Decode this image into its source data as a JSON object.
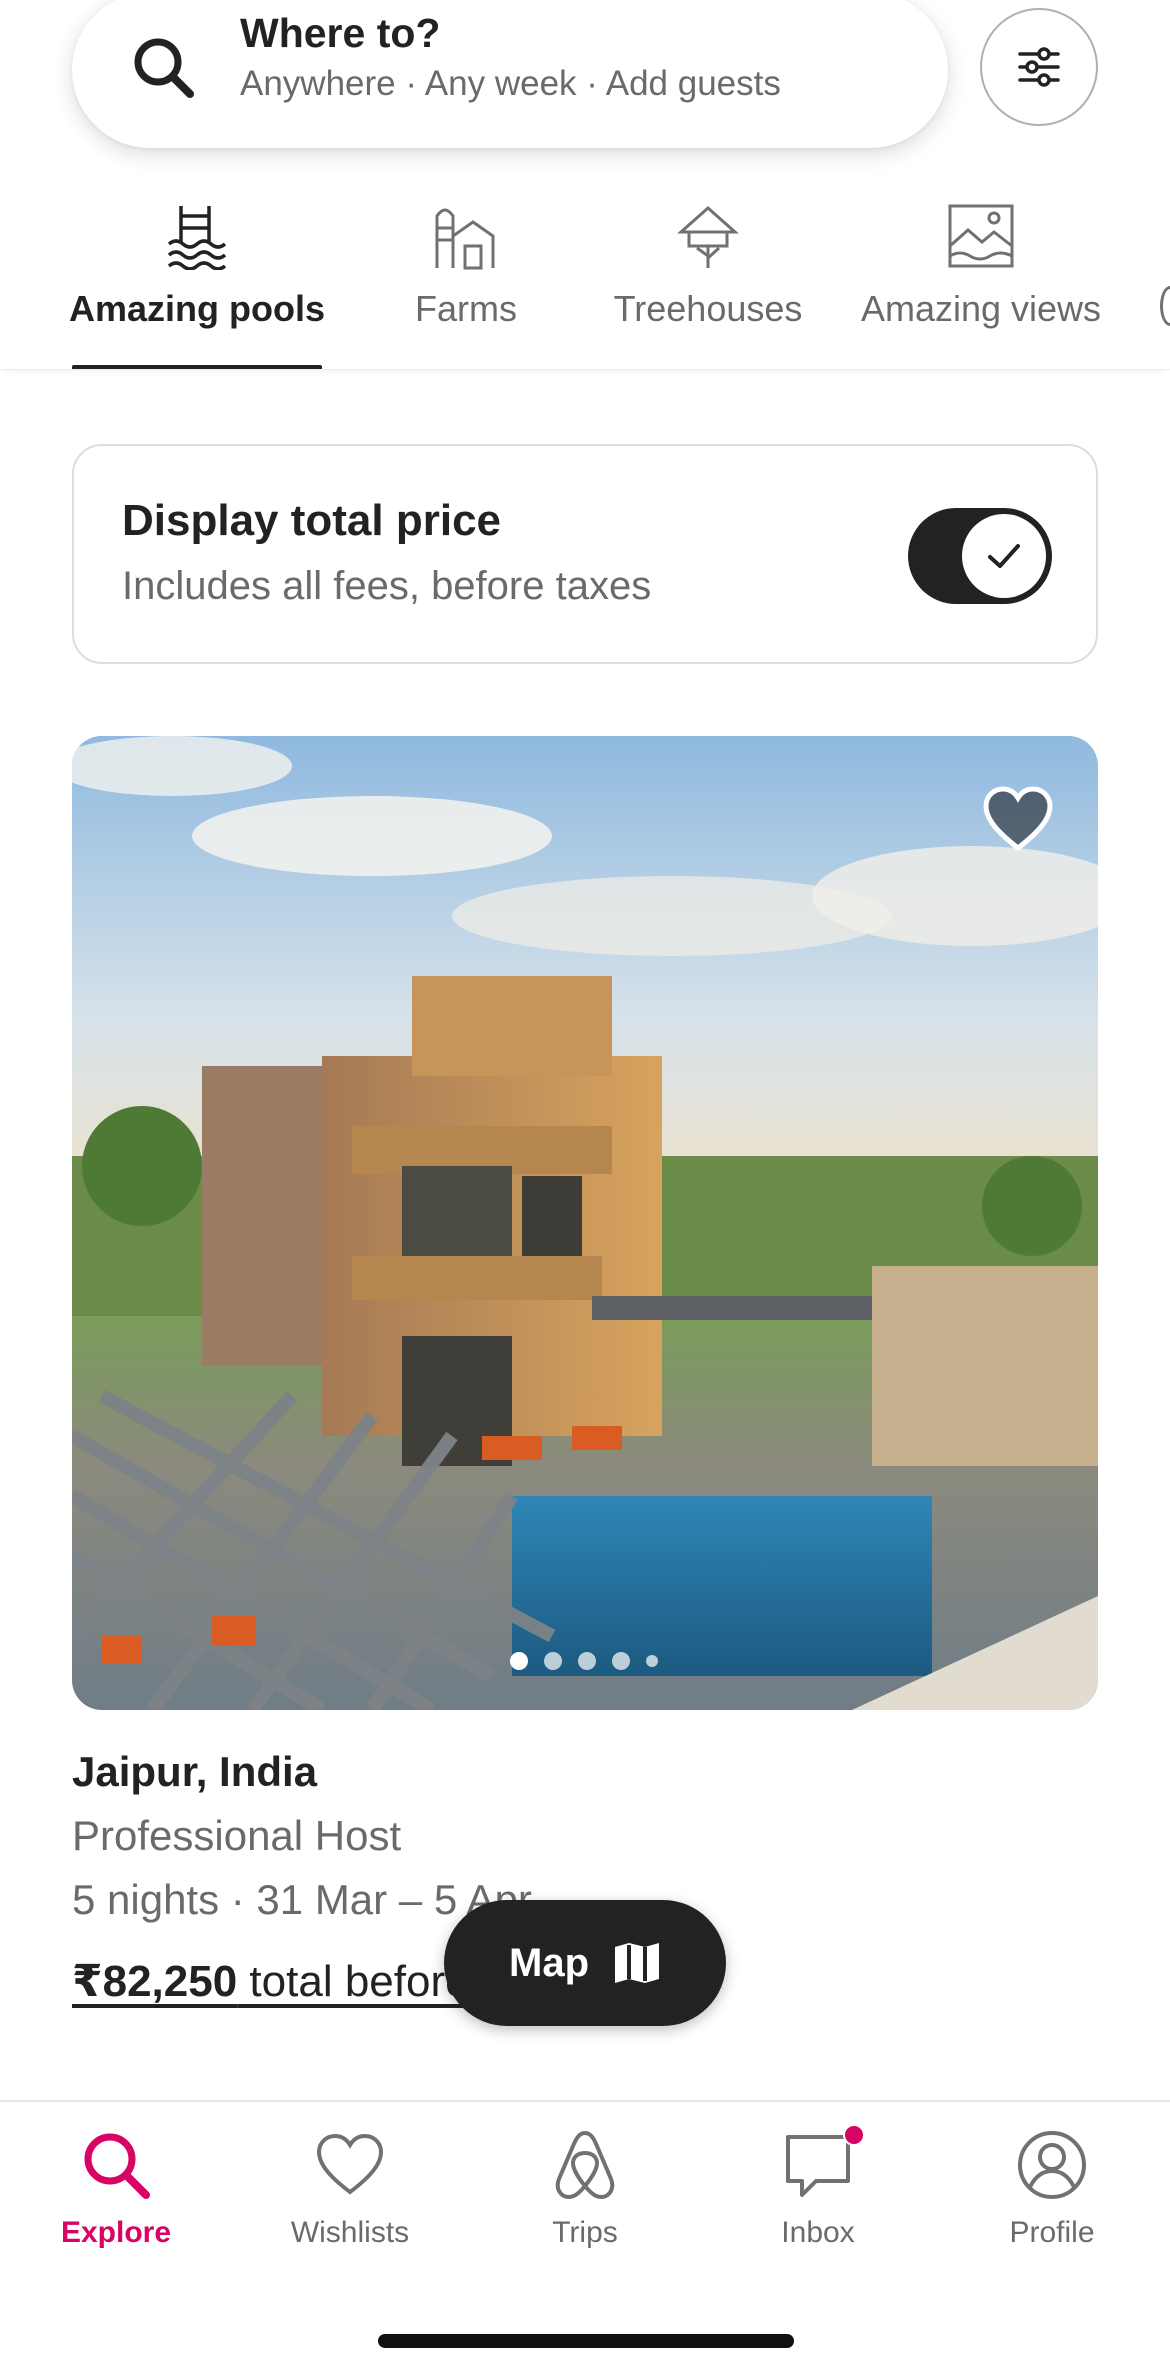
{
  "search": {
    "title": "Where to?",
    "subtitle": "Anywhere · Any week · Add guests",
    "icon": "search-icon",
    "filter_icon": "sliders-icon"
  },
  "categories": [
    {
      "label": "Amazing pools",
      "icon": "pool-icon",
      "active": true
    },
    {
      "label": "Farms",
      "icon": "farm-icon",
      "active": false
    },
    {
      "label": "Treehouses",
      "icon": "treehouse-icon",
      "active": false
    },
    {
      "label": "Amazing views",
      "icon": "view-icon",
      "active": false
    }
  ],
  "price_toggle": {
    "title": "Display total price",
    "subtitle": "Includes all fees, before taxes",
    "enabled": true
  },
  "listing": {
    "location": "Jaipur, India",
    "host": "Professional Host",
    "dates": "5 nights · 31 Mar – 5 Apr",
    "price": "₹82,250",
    "price_suffix": " total before taxes",
    "photo_count": 5,
    "photo_index": 1
  },
  "map_button": {
    "label": "Map",
    "icon": "map-icon"
  },
  "nav": [
    {
      "label": "Explore",
      "icon": "search-icon",
      "active": true
    },
    {
      "label": "Wishlists",
      "icon": "heart-icon",
      "active": false
    },
    {
      "label": "Trips",
      "icon": "airbnb-logo-icon",
      "active": false
    },
    {
      "label": "Inbox",
      "icon": "message-icon",
      "active": false,
      "badge": true
    },
    {
      "label": "Profile",
      "icon": "profile-icon",
      "active": false
    }
  ],
  "colors": {
    "accent": "#d70466",
    "text": "#222222",
    "muted": "#6a6a6a"
  }
}
